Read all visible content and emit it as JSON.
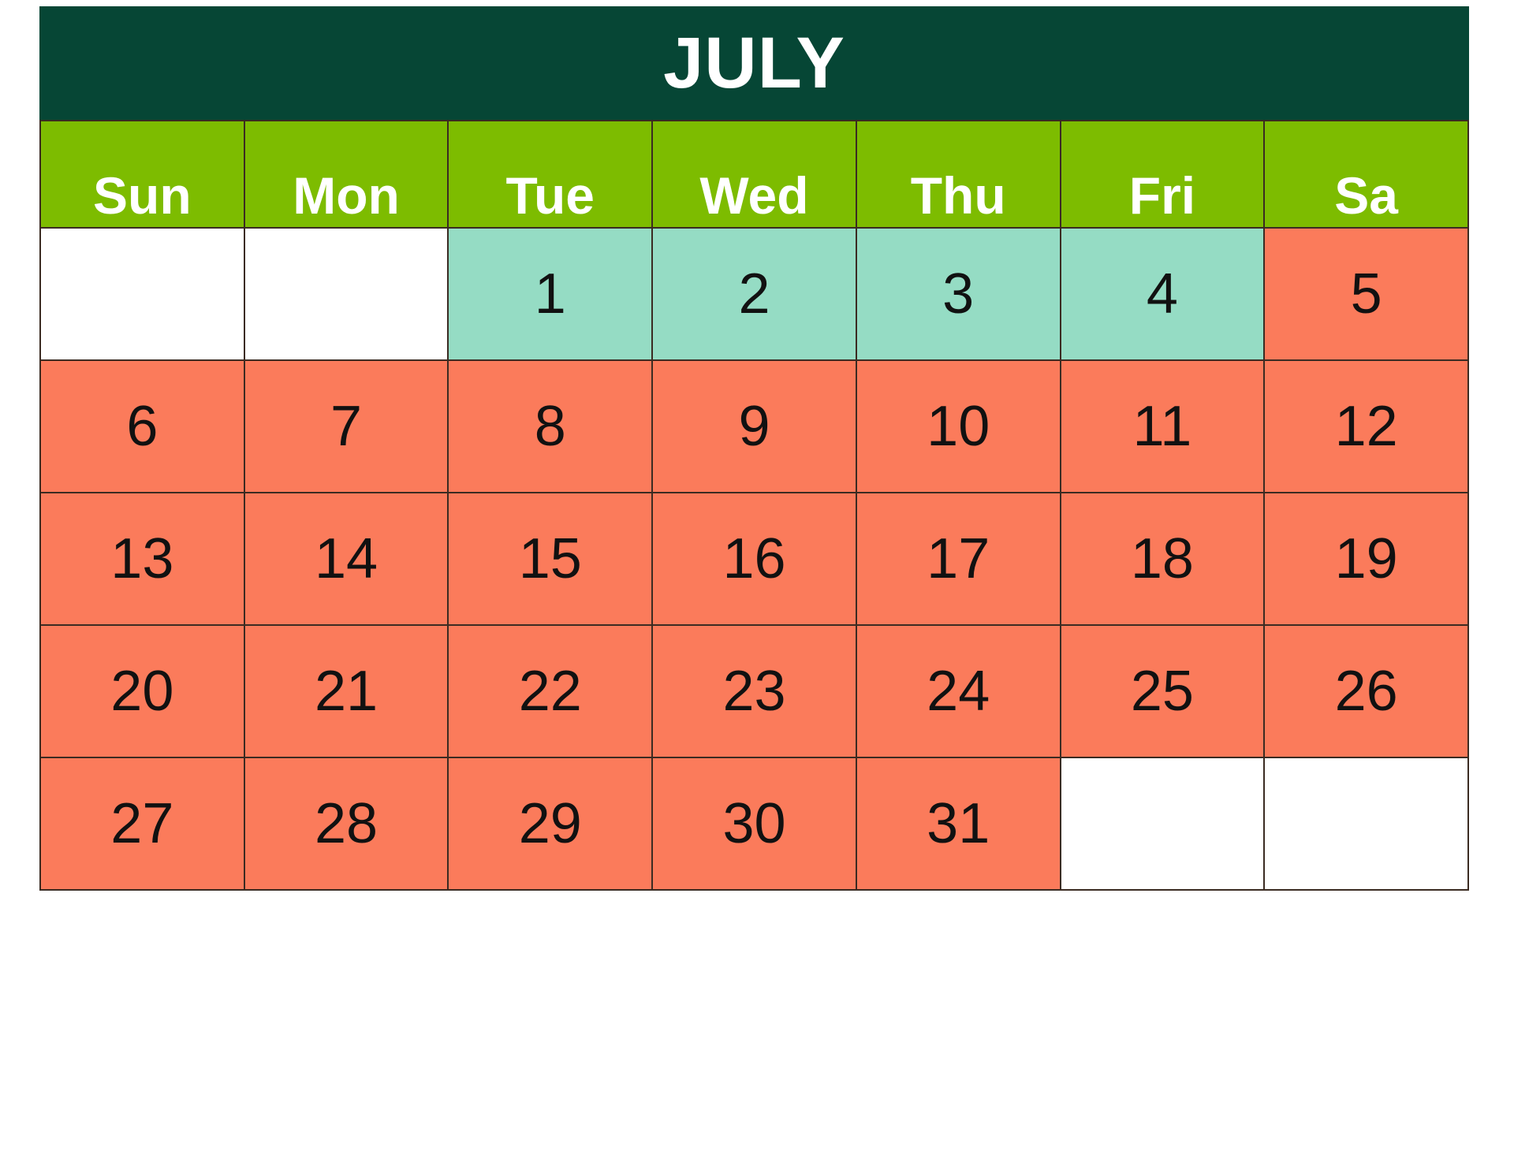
{
  "calendar": {
    "title": "JULY",
    "colors": {
      "title_bar": "#064635",
      "dow_header": "#7DBC00",
      "mint": "#95DCC4",
      "coral": "#FB7B5B",
      "empty": "#FFFFFF",
      "border": "#3B2B22",
      "title_text": "#FFFFFF",
      "dow_text": "#FFFFFF",
      "day_text": "#111111"
    },
    "day_headers": [
      {
        "label": "Sun"
      },
      {
        "label": "Mon"
      },
      {
        "label": "Tue"
      },
      {
        "label": "Wed"
      },
      {
        "label": "Thu"
      },
      {
        "label": "Fri"
      },
      {
        "label": "Sa"
      }
    ],
    "weeks": [
      [
        {
          "label": "",
          "fill": "empty"
        },
        {
          "label": "",
          "fill": "empty"
        },
        {
          "label": "1",
          "fill": "mint"
        },
        {
          "label": "2",
          "fill": "mint"
        },
        {
          "label": "3",
          "fill": "mint"
        },
        {
          "label": "4",
          "fill": "mint"
        },
        {
          "label": "5",
          "fill": "coral"
        }
      ],
      [
        {
          "label": "6",
          "fill": "coral"
        },
        {
          "label": "7",
          "fill": "coral"
        },
        {
          "label": "8",
          "fill": "coral"
        },
        {
          "label": "9",
          "fill": "coral"
        },
        {
          "label": "10",
          "fill": "coral"
        },
        {
          "label": "11",
          "fill": "coral"
        },
        {
          "label": "12",
          "fill": "coral"
        }
      ],
      [
        {
          "label": "13",
          "fill": "coral"
        },
        {
          "label": "14",
          "fill": "coral"
        },
        {
          "label": "15",
          "fill": "coral"
        },
        {
          "label": "16",
          "fill": "coral"
        },
        {
          "label": "17",
          "fill": "coral"
        },
        {
          "label": "18",
          "fill": "coral"
        },
        {
          "label": "19",
          "fill": "coral"
        }
      ],
      [
        {
          "label": "20",
          "fill": "coral"
        },
        {
          "label": "21",
          "fill": "coral"
        },
        {
          "label": "22",
          "fill": "coral"
        },
        {
          "label": "23",
          "fill": "coral"
        },
        {
          "label": "24",
          "fill": "coral"
        },
        {
          "label": "25",
          "fill": "coral"
        },
        {
          "label": "26",
          "fill": "coral"
        }
      ],
      [
        {
          "label": "27",
          "fill": "coral"
        },
        {
          "label": "28",
          "fill": "coral"
        },
        {
          "label": "29",
          "fill": "coral"
        },
        {
          "label": "30",
          "fill": "coral"
        },
        {
          "label": "31",
          "fill": "coral"
        },
        {
          "label": "",
          "fill": "empty"
        },
        {
          "label": "",
          "fill": "empty"
        }
      ]
    ]
  }
}
